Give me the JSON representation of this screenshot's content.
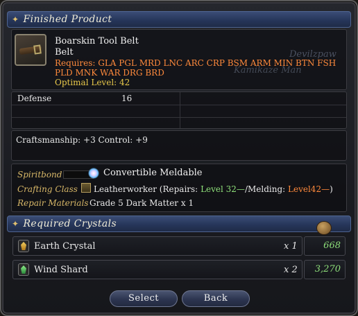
{
  "finished_product": {
    "header": "Finished Product",
    "item_name": "Boarskin Tool Belt",
    "item_type": "Belt",
    "requires": "Requires: GLA PGL MRD LNC ARC CRP BSM ARM MIN BTN FSH",
    "requires_line2": "PLD MNK WAR DRG BRD",
    "optimal_level": "Optimal Level: 42",
    "background_text_1": "Devilzpaw",
    "background_text_2": "Kamikaze Man",
    "defense_label": "Defense",
    "defense_value": "16",
    "stats": "Craftsmanship: +3  Control: +9",
    "spiritbond_label": "Spiritbond",
    "meldable": "Convertible Meldable",
    "crafting_class_label": "Crafting Class",
    "crafting_class": "Leatherworker",
    "repairs_prefix": "(Repairs:",
    "repairs_level": "Level 32—",
    "melding_prefix": "/Melding:",
    "melding_level": "Level42—",
    "close_paren": ")",
    "repair_materials_label": "Repair Materials",
    "repair_materials": "Grade 5 Dark Matter   x 1"
  },
  "required_crystals": {
    "header": "Required Crystals",
    "items": [
      {
        "name": "Earth Crystal",
        "qty": "x 1",
        "have": "668",
        "icon": "earth-crystal-icon"
      },
      {
        "name": "Wind Shard",
        "qty": "x 2",
        "have": "3,270",
        "icon": "wind-shard-icon"
      }
    ]
  },
  "buttons": {
    "select": "Select",
    "back": "Back"
  }
}
